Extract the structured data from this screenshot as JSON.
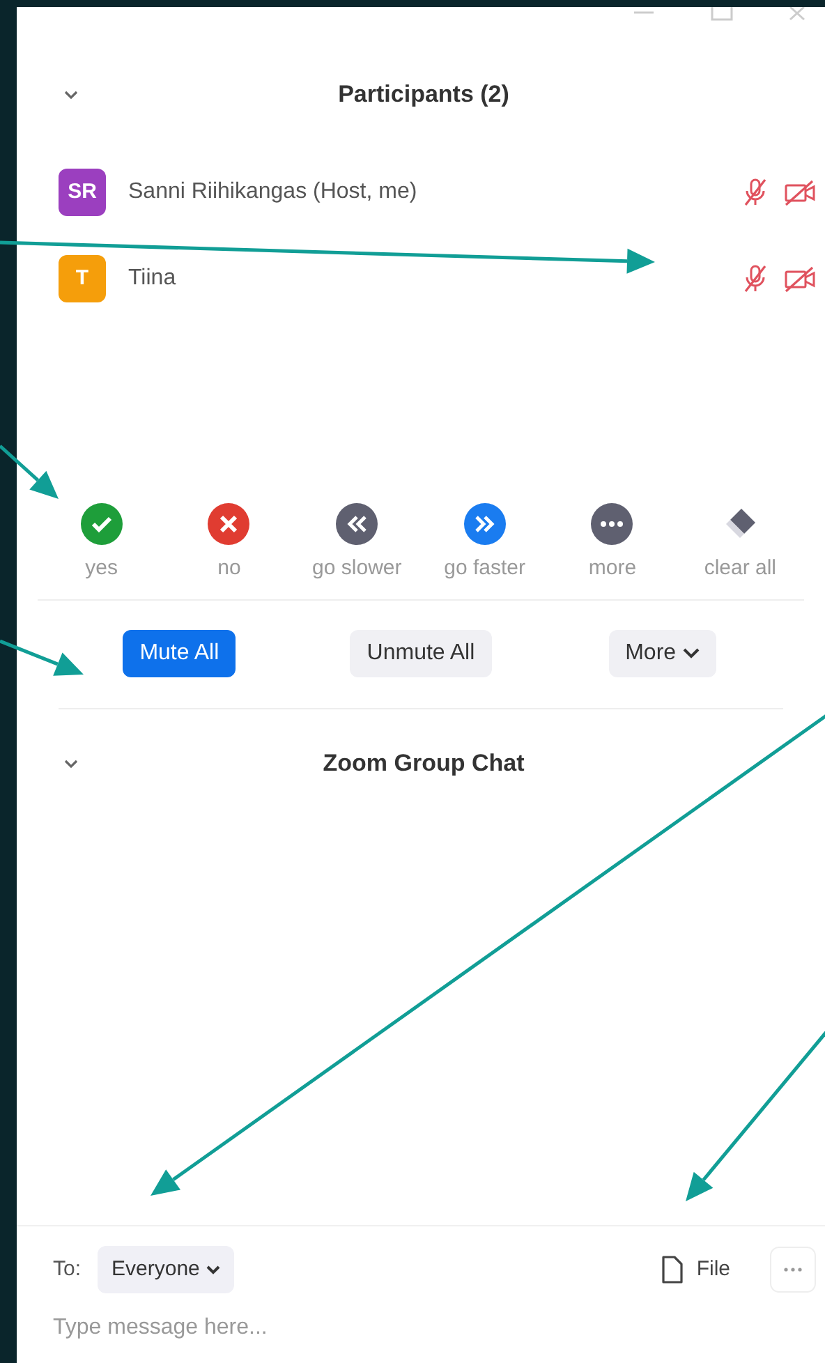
{
  "participants": {
    "title": "Participants (2)",
    "expanded": true,
    "people": [
      {
        "initials": "SR",
        "name": "Sanni Riihikangas (Host, me)",
        "color": "#9b3fbf",
        "muted": true,
        "video_off": true
      },
      {
        "initials": "T",
        "name": "Tiina",
        "color": "#f59e0b",
        "muted": true,
        "video_off": true
      }
    ]
  },
  "reactions": [
    {
      "kind": "check",
      "label": "yes"
    },
    {
      "kind": "cross",
      "label": "no"
    },
    {
      "kind": "slower",
      "label": "go slower"
    },
    {
      "kind": "faster",
      "label": "go faster"
    },
    {
      "kind": "dots",
      "label": "more"
    },
    {
      "kind": "eraser",
      "label": "clear all"
    }
  ],
  "actions": [
    {
      "kind": "primary",
      "label": "Mute All"
    },
    {
      "kind": "secondary",
      "label": "Unmute All"
    },
    {
      "kind": "menu",
      "label": "More"
    }
  ],
  "chat": {
    "title": "Zoom Group Chat",
    "expanded": true,
    "to_label": "To:",
    "recipient": "Everyone",
    "file_label": "File",
    "placeholder": "Type message here..."
  }
}
